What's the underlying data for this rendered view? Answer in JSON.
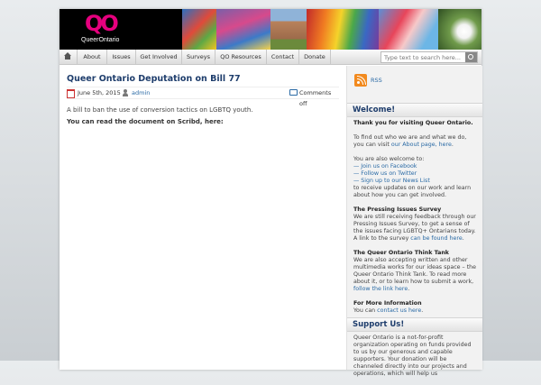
{
  "header": {
    "logo_mark": "QO",
    "logo_text": "QueerOntario"
  },
  "nav": {
    "items": [
      "About",
      "Issues",
      "Get Involved",
      "Surveys",
      "QO Resources",
      "Contact",
      "Donate"
    ],
    "search_placeholder": "Type text to search here..."
  },
  "post": {
    "title": "Queer Ontario Deputation on Bill 77",
    "date": "June 5th, 2015",
    "author": "admin",
    "comments": "Comments off",
    "excerpt": "A bill to ban the use of conversion tactics on LGBTQ youth.",
    "scribd": "You can read the document on Scribd, here:"
  },
  "sidebar": {
    "rss": "RSS",
    "welcome": {
      "title": "Welcome!",
      "thanks": "Thank you for visiting Queer Ontario.",
      "find_out": "To find out who we are and what we do, you can visit ",
      "about_link": "our About page, here",
      "also": "You are also welcome to:",
      "links": [
        "— Join us on Facebook",
        "— Follow us on Twitter",
        "— Sign up to our News List"
      ],
      "receive": "to receive updates on our work and learn about how you can get involved.",
      "survey_title": "The Pressing Issues Survey",
      "survey_text": "We are still receiving feedback through our Pressing Issues Survey, to get a sense of the issues facing LGBTQ+ Ontarians today. A link to the survey ",
      "survey_link": "can be found here",
      "think_title": "The Queer Ontario Think Tank",
      "think_text": "We are also accepting written and other multimedia works for our ideas space – the Queer Ontario Think Tank. To read more about it, or to learn how to submit a work, ",
      "think_link": "follow the link here",
      "info_title": "For More Information",
      "info_text": "You can ",
      "info_link": "contact us here"
    },
    "support": {
      "title": "Support Us!",
      "text": "Queer Ontario is a not-for-profit organization operating on funds provided to us by our generous and capable supporters. Your donation will be channeled directly into our projects and operations, which will help us"
    }
  },
  "colors": {
    "accent": "#e6007e",
    "title_blue": "#1e3d6c",
    "link_blue": "#2a6aa5",
    "rss_orange": "#f28a1e"
  }
}
